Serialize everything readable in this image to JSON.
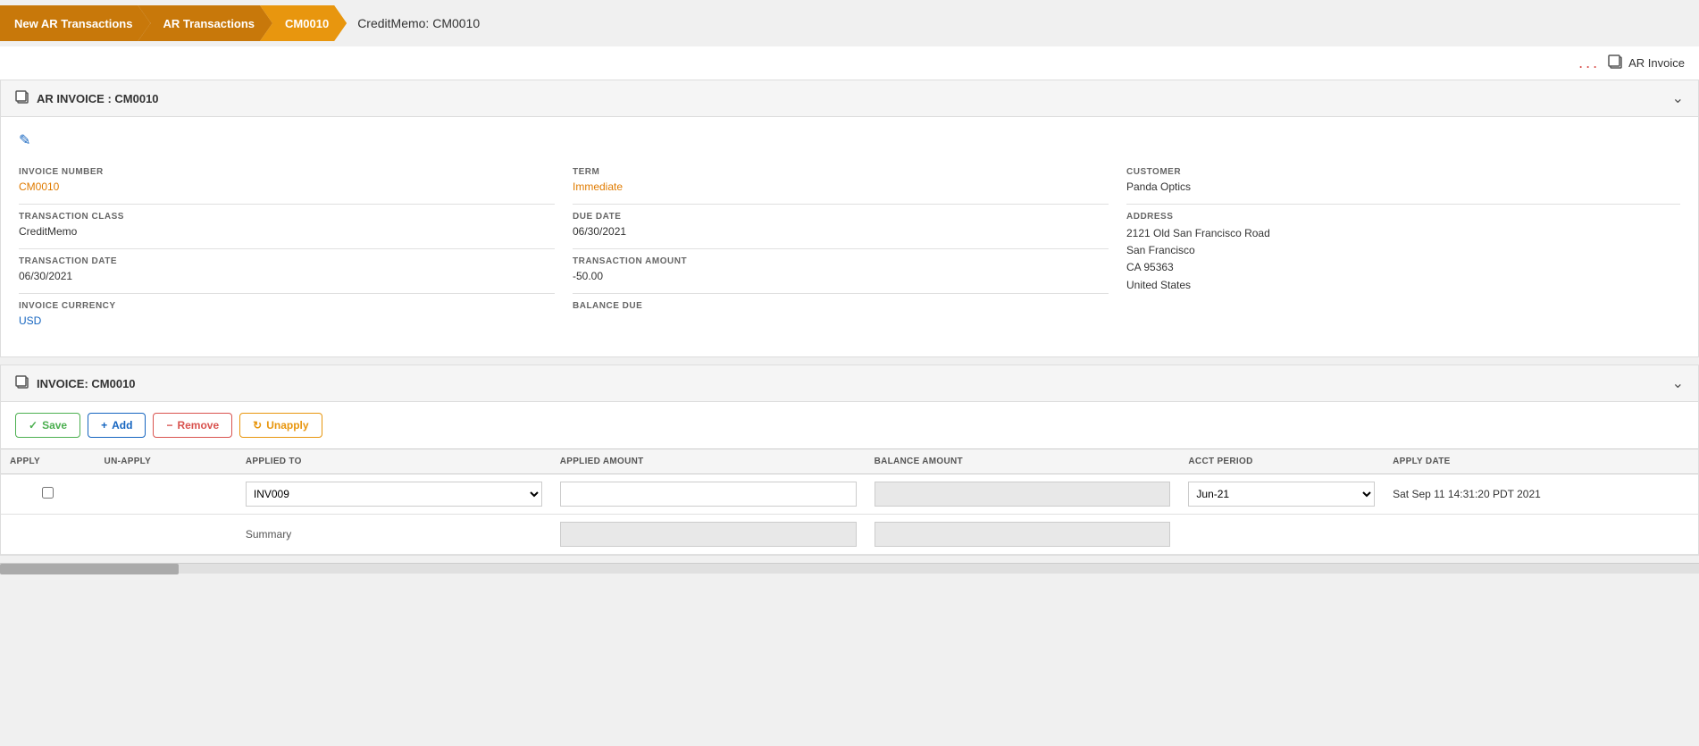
{
  "breadcrumb": {
    "item1": "New AR Transactions",
    "item2": "AR Transactions",
    "item3": "CM0010",
    "current": "CreditMemo: CM0010"
  },
  "topbar": {
    "dots": "...",
    "ar_invoice_label": "AR Invoice"
  },
  "ar_invoice_section": {
    "title": "AR INVOICE : CM0010",
    "edit_tooltip": "Edit"
  },
  "invoice_fields": {
    "invoice_number_label": "INVOICE NUMBER",
    "invoice_number_value": "CM0010",
    "transaction_class_label": "TRANSACTION CLASS",
    "transaction_class_value": "CreditMemo",
    "transaction_date_label": "TRANSACTION DATE",
    "transaction_date_value": "06/30/2021",
    "invoice_currency_label": "INVOICE CURRENCY",
    "invoice_currency_value": "USD",
    "term_label": "TERM",
    "term_value": "Immediate",
    "due_date_label": "DUE DATE",
    "due_date_value": "06/30/2021",
    "transaction_amount_label": "TRANSACTION AMOUNT",
    "transaction_amount_value": "-50.00",
    "balance_due_label": "BALANCE DUE",
    "balance_due_value": "",
    "customer_label": "CUSTOMER",
    "customer_value": "Panda Optics",
    "address_label": "ADDRESS",
    "address_line1": "2121 Old San Francisco Road",
    "address_line2": "San Francisco",
    "address_line3": "CA 95363",
    "address_line4": "United States"
  },
  "invoice_section": {
    "title": "INVOICE: CM0010"
  },
  "toolbar": {
    "save_label": "Save",
    "add_label": "Add",
    "remove_label": "Remove",
    "unapply_label": "Unapply"
  },
  "table": {
    "headers": {
      "apply": "APPLY",
      "unapply": "UN-APPLY",
      "applied_to": "APPLIED TO",
      "applied_amount": "APPLIED AMOUNT",
      "balance_amount": "BALANCE AMOUNT",
      "acct_period": "ACCT PERIOD",
      "apply_date": "APPLY DATE"
    },
    "rows": [
      {
        "applied_to": "INV009",
        "applied_amount": "",
        "balance_amount": "",
        "acct_period": "Jun-21",
        "apply_date": "Sat Sep 11 14:31:20 PDT 2021"
      }
    ],
    "summary_label": "Summary"
  }
}
